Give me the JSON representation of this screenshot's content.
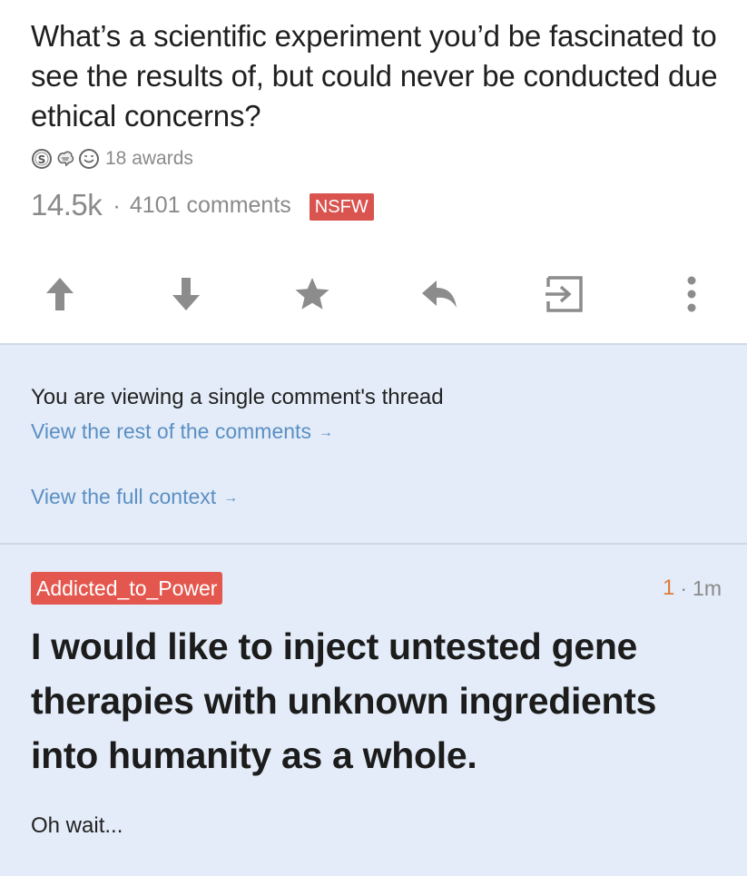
{
  "post": {
    "title": "What’s a scientific experiment you’d be fascinated to see the results of, but could never be conducted due ethical concerns?",
    "awards_label": "18 awards",
    "score": "14.5k",
    "separator": "·",
    "comments_label": "4101 comments",
    "nsfw_label": "NSFW",
    "award_icons": [
      "silver-award-icon",
      "helpful-award-icon",
      "wholesome-award-icon"
    ]
  },
  "actions": [
    "upvote-icon",
    "downvote-icon",
    "save-star-icon",
    "reply-icon",
    "share-exit-icon",
    "more-vertical-icon"
  ],
  "context": {
    "note": "You are viewing a single comment's thread",
    "rest_link": "View the rest of the comments",
    "full_context_link": "View the full context",
    "arrow": "→"
  },
  "comment": {
    "author": "Addicted_to_Power",
    "score": "1",
    "separator": "·",
    "age": "1m",
    "headline": "I would like to inject untested gene therapies with unknown ingredients into humanity as a whole.",
    "tail": "Oh wait..."
  },
  "colors": {
    "nsfw_badge": "#d9534f",
    "author_badge": "#e4574e",
    "link": "#5b8fc4",
    "banner_bg": "#e3ecf8",
    "score_accent": "#e07b39",
    "icon_gray": "#8c8c8c"
  }
}
